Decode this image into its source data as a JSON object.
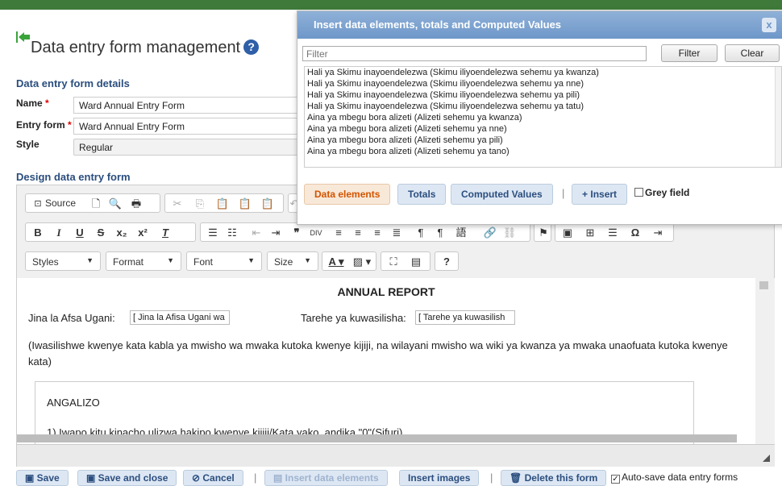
{
  "page": {
    "title": "Data entry form management",
    "details_heading": "Data entry form details",
    "design_heading": "Design data entry form"
  },
  "form": {
    "name_label": "Name",
    "name_value": "Ward Annual Entry Form",
    "entry_form_label": "Entry form",
    "entry_form_value": "Ward Annual Entry Form",
    "style_label": "Style",
    "style_value": "Regular",
    "required_mark": "*"
  },
  "toolbar": {
    "source_label": "Source",
    "styles_label": "Styles",
    "format_label": "Format",
    "font_label": "Font",
    "size_label": "Size",
    "help_label": "?"
  },
  "document": {
    "heading": "ANNUAL REPORT",
    "officer_label": "Jina la Afsa Ugani:",
    "officer_value": "[ Jina la Afisa Ugani wa",
    "date_label": "Tarehe ya kuwasilisha:",
    "date_value": "[ Tarehe ya kuwasilish",
    "instruction": "(Iwasilishwe kwenye kata kabla ya mwisho wa mwaka kutoka kwenye kijiji, na wilayani mwisho wa wiki ya kwanza ya mwaka unaofuata kutoka kwenye kata)",
    "box_title": "ANGALIZO",
    "box_line": "1) Iwapo kitu kinacho ulizwa hakipo kwenye kijiji/Kata yako, andika \"0\"(Sifuri)"
  },
  "bottom": {
    "save": "Save",
    "save_close": "Save and close",
    "cancel": "Cancel",
    "insert_elements": "Insert data elements",
    "insert_images": "Insert images",
    "delete_form": "Delete this form",
    "autosave": "Auto-save data entry forms",
    "separator": "|"
  },
  "dialog": {
    "title": "Insert data elements, totals and Computed Values",
    "close": "x",
    "filter_placeholder": "Filter",
    "filter_button": "Filter",
    "clear_button": "Clear",
    "items": [
      "Hali ya Skimu inayoendelezwa (Skimu iliyoendelezwa sehemu ya kwanza)",
      "Hali ya Skimu inayoendelezwa (Skimu iliyoendelezwa sehemu ya nne)",
      "Hali ya Skimu inayoendelezwa (Skimu iliyoendelezwa sehemu ya pili)",
      "Hali ya Skimu inayoendelezwa (Skimu iliyoendelezwa sehemu ya tatu)",
      "Aina ya mbegu bora alizeti (Alizeti sehemu ya kwanza)",
      "Aina ya mbegu bora alizeti (Alizeti sehemu ya nne)",
      "Aina ya mbegu bora alizeti (Alizeti sehemu ya pili)",
      "Aina ya mbegu bora alizeti (Alizeti sehemu ya tano)"
    ],
    "tab_data_elements": "Data elements",
    "tab_totals": "Totals",
    "tab_computed": "Computed Values",
    "insert_button": "Insert",
    "insert_plus": "+",
    "grey_field": "Grey field",
    "separator": "|"
  },
  "colors": {
    "topbar": "#3f7a3a",
    "heading_blue": "#2b4e7e",
    "dialog_header": "#6e97c9",
    "active_tab": "#d35400",
    "required": "#dd0000"
  }
}
